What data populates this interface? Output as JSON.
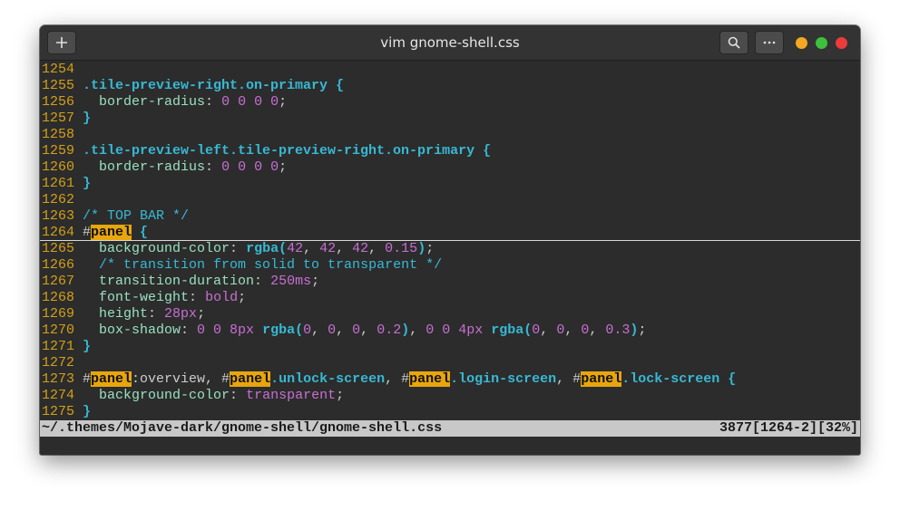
{
  "window": {
    "title": "vim gnome-shell.css",
    "controls": {
      "minimize_color": "#f5a623",
      "maximize_color": "#3ec03e",
      "close_color": "#ec3b3b"
    },
    "icons": [
      "plus-icon",
      "search-icon",
      "ellipsis-icon"
    ]
  },
  "editor": {
    "lines": [
      {
        "n": "1254",
        "tokens": []
      },
      {
        "n": "1255",
        "tokens": [
          [
            "sel",
            ".tile-preview-right.on-primary"
          ],
          [
            "plain",
            " "
          ],
          [
            "brace",
            "{"
          ]
        ]
      },
      {
        "n": "1256",
        "tokens": [
          [
            "plain",
            "  "
          ],
          [
            "prop",
            "border-radius"
          ],
          [
            "plain",
            ": "
          ],
          [
            "val",
            "0 0 0 0"
          ],
          [
            "plain",
            ";"
          ]
        ]
      },
      {
        "n": "1257",
        "tokens": [
          [
            "brace",
            "}"
          ]
        ]
      },
      {
        "n": "1258",
        "tokens": []
      },
      {
        "n": "1259",
        "tokens": [
          [
            "sel",
            ".tile-preview-left.tile-preview-right.on-primary"
          ],
          [
            "plain",
            " "
          ],
          [
            "brace",
            "{"
          ]
        ]
      },
      {
        "n": "1260",
        "tokens": [
          [
            "plain",
            "  "
          ],
          [
            "prop",
            "border-radius"
          ],
          [
            "plain",
            ": "
          ],
          [
            "val",
            "0 0 0 0"
          ],
          [
            "plain",
            ";"
          ]
        ]
      },
      {
        "n": "1261",
        "tokens": [
          [
            "brace",
            "}"
          ]
        ]
      },
      {
        "n": "1262",
        "tokens": []
      },
      {
        "n": "1263",
        "tokens": [
          [
            "comment",
            "/* TOP BAR */"
          ]
        ]
      },
      {
        "n": "1264",
        "cursorline": true,
        "tokens": [
          [
            "hash",
            "#"
          ],
          [
            "hl",
            "panel"
          ],
          [
            "plain",
            " "
          ],
          [
            "brace",
            "{"
          ]
        ]
      },
      {
        "n": "1265",
        "tokens": [
          [
            "plain",
            "  "
          ],
          [
            "prop",
            "background-color"
          ],
          [
            "plain",
            ": "
          ],
          [
            "fn",
            "rgba("
          ],
          [
            "val",
            "42"
          ],
          [
            "plain",
            ", "
          ],
          [
            "val",
            "42"
          ],
          [
            "plain",
            ", "
          ],
          [
            "val",
            "42"
          ],
          [
            "plain",
            ", "
          ],
          [
            "val",
            "0.15"
          ],
          [
            "fn",
            ")"
          ],
          [
            "plain",
            ";"
          ]
        ]
      },
      {
        "n": "1266",
        "tokens": [
          [
            "plain",
            "  "
          ],
          [
            "comment",
            "/* transition from solid to transparent */"
          ]
        ]
      },
      {
        "n": "1267",
        "tokens": [
          [
            "plain",
            "  "
          ],
          [
            "prop",
            "transition-duration"
          ],
          [
            "plain",
            ": "
          ],
          [
            "val",
            "250ms"
          ],
          [
            "plain",
            ";"
          ]
        ]
      },
      {
        "n": "1268",
        "tokens": [
          [
            "plain",
            "  "
          ],
          [
            "prop",
            "font-weight"
          ],
          [
            "plain",
            ": "
          ],
          [
            "val",
            "bold"
          ],
          [
            "plain",
            ";"
          ]
        ]
      },
      {
        "n": "1269",
        "tokens": [
          [
            "plain",
            "  "
          ],
          [
            "prop",
            "height"
          ],
          [
            "plain",
            ": "
          ],
          [
            "val",
            "28px"
          ],
          [
            "plain",
            ";"
          ]
        ]
      },
      {
        "n": "1270",
        "tokens": [
          [
            "plain",
            "  "
          ],
          [
            "prop",
            "box-shadow"
          ],
          [
            "plain",
            ": "
          ],
          [
            "val",
            "0 0 8px"
          ],
          [
            "plain",
            " "
          ],
          [
            "fn",
            "rgba("
          ],
          [
            "val",
            "0"
          ],
          [
            "plain",
            ", "
          ],
          [
            "val",
            "0"
          ],
          [
            "plain",
            ", "
          ],
          [
            "val",
            "0"
          ],
          [
            "plain",
            ", "
          ],
          [
            "val",
            "0.2"
          ],
          [
            "fn",
            ")"
          ],
          [
            "plain",
            ", "
          ],
          [
            "val",
            "0 0 4px"
          ],
          [
            "plain",
            " "
          ],
          [
            "fn",
            "rgba("
          ],
          [
            "val",
            "0"
          ],
          [
            "plain",
            ", "
          ],
          [
            "val",
            "0"
          ],
          [
            "plain",
            ", "
          ],
          [
            "val",
            "0"
          ],
          [
            "plain",
            ", "
          ],
          [
            "val",
            "0.3"
          ],
          [
            "fn",
            ")"
          ],
          [
            "plain",
            ";"
          ]
        ]
      },
      {
        "n": "1271",
        "tokens": [
          [
            "brace",
            "}"
          ]
        ]
      },
      {
        "n": "1272",
        "tokens": []
      },
      {
        "n": "1273",
        "tokens": [
          [
            "hash",
            "#"
          ],
          [
            "hl",
            "panel"
          ],
          [
            "plain",
            ":overview, #"
          ],
          [
            "hl",
            "panel"
          ],
          [
            "sel",
            ".unlock-screen"
          ],
          [
            "plain",
            ", #"
          ],
          [
            "hl",
            "panel"
          ],
          [
            "sel",
            ".login-screen"
          ],
          [
            "plain",
            ", #"
          ],
          [
            "hl",
            "panel"
          ],
          [
            "sel",
            ".lock-screen"
          ],
          [
            "plain",
            " "
          ],
          [
            "brace",
            "{"
          ]
        ]
      },
      {
        "n": "1274",
        "tokens": [
          [
            "plain",
            "  "
          ],
          [
            "prop",
            "background-color"
          ],
          [
            "plain",
            ": "
          ],
          [
            "val",
            "transparent"
          ],
          [
            "plain",
            ";"
          ]
        ]
      },
      {
        "n": "1275",
        "tokens": [
          [
            "brace",
            "}"
          ]
        ]
      }
    ]
  },
  "statusline": {
    "path": "~/.themes/Mojave-dark/gnome-shell/gnome-shell.css",
    "position": "3877[1264-2][32%]"
  }
}
